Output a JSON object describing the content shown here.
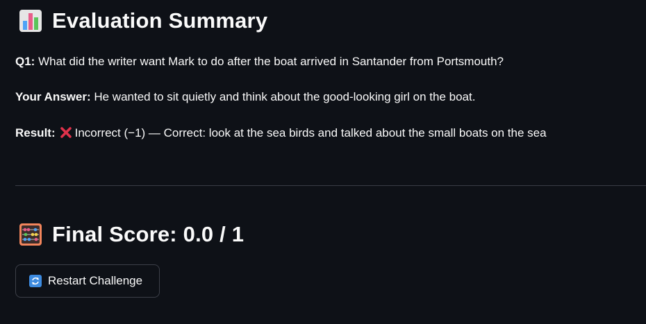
{
  "summary": {
    "title": "Evaluation Summary",
    "icon": "bar-chart-icon"
  },
  "question": {
    "label": "Q1:",
    "text": " What did the writer want Mark to do after the boat arrived in Santander from Portsmouth?"
  },
  "answer": {
    "label": "Your Answer:",
    "text": " He wanted to sit quietly and think about the good-looking girl on the boat."
  },
  "result": {
    "label": "Result:",
    "icon": "cross-mark-icon",
    "text": "Incorrect (−1) — Correct: look at the sea birds and talked about the small boats on the sea"
  },
  "score": {
    "title": "Final Score: 0.0 / 1",
    "icon": "abacus-icon"
  },
  "restart": {
    "label": "Restart Challenge",
    "icon": "restart-arrows-icon"
  },
  "colors": {
    "background": "#0e1117",
    "text": "#fafafa",
    "error": "#e0324b"
  }
}
